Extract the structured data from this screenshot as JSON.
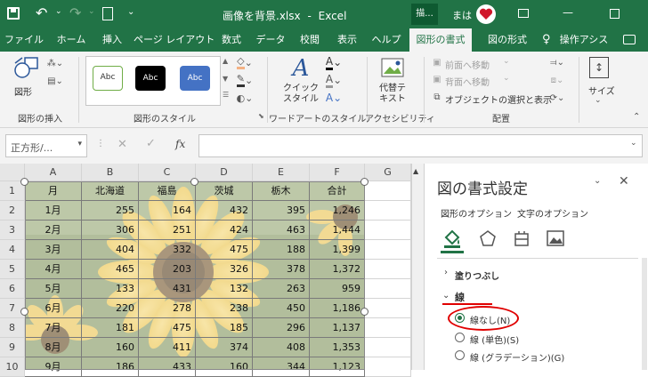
{
  "titlebar": {
    "filename": "画像を背景.xlsx",
    "dash": "-",
    "app": "Excel",
    "context_tab": "描...",
    "user": "まは",
    "minimize": "—",
    "color": "#217346"
  },
  "tabs": [
    "ファイル",
    "ホーム",
    "挿入",
    "ページ レイアウト",
    "数式",
    "データ",
    "校閲",
    "表示",
    "ヘルプ",
    "図形の書式",
    "図の形式",
    "操作アシス"
  ],
  "ribbon": {
    "insert_shape_label": "図形",
    "group_insert": "図形の挿入",
    "style_samples": [
      "Abc",
      "Abc",
      "Abc"
    ],
    "group_styles": "図形のスタイル",
    "quick_style": "クイック\nスタイル",
    "group_wordart": "ワードアートのスタイル",
    "alt_text": "代替テ\nキスト",
    "group_access": "アクセシビリティ",
    "bring_forward": "前面へ移動",
    "send_backward": "背面へ移動",
    "selection_pane": "オブジェクトの選択と表示",
    "group_arrange": "配置",
    "size": "サイズ"
  },
  "formula": {
    "name_box": "正方形/...",
    "fx": "fx"
  },
  "sheet": {
    "columns": [
      "A",
      "B",
      "C",
      "D",
      "E",
      "F",
      "G"
    ],
    "rows": [
      "1",
      "2",
      "3",
      "4",
      "5",
      "6",
      "7",
      "8",
      "9",
      "10"
    ],
    "headers": [
      "月",
      "北海道",
      "福島",
      "茨城",
      "栃木",
      "合計"
    ],
    "data": [
      [
        "1月",
        "255",
        "164",
        "432",
        "395",
        "1,246"
      ],
      [
        "2月",
        "306",
        "251",
        "424",
        "463",
        "1,444"
      ],
      [
        "3月",
        "404",
        "332",
        "475",
        "188",
        "1,399"
      ],
      [
        "4月",
        "465",
        "203",
        "326",
        "378",
        "1,372"
      ],
      [
        "5月",
        "133",
        "431",
        "132",
        "263",
        "959"
      ],
      [
        "6月",
        "220",
        "278",
        "238",
        "450",
        "1,186"
      ],
      [
        "7月",
        "181",
        "475",
        "185",
        "296",
        "1,137"
      ],
      [
        "8月",
        "160",
        "411",
        "374",
        "408",
        "1,353"
      ],
      [
        "9月",
        "186",
        "433",
        "160",
        "344",
        "1,123"
      ]
    ]
  },
  "pane": {
    "title": "図の書式設定",
    "tab_shape": "図形のオプション",
    "tab_text": "文字のオプション",
    "fill_section": "塗りつぶし",
    "line_section": "線",
    "opt_none": "線なし(N)",
    "opt_solid": "線 (単色)(S)",
    "opt_gradient": "線 (グラデーション)(G)"
  }
}
